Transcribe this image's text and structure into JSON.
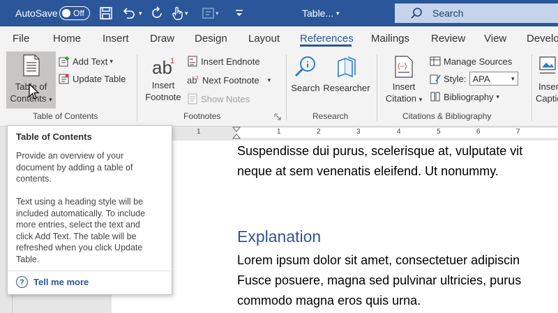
{
  "titlebar": {
    "autosave_label": "AutoSave",
    "autosave_state": "Off",
    "doc_title": "Table...",
    "search_placeholder": "Search"
  },
  "menu": {
    "tabs": [
      {
        "label": "File"
      },
      {
        "label": "Home"
      },
      {
        "label": "Insert"
      },
      {
        "label": "Draw"
      },
      {
        "label": "Design"
      },
      {
        "label": "Layout"
      },
      {
        "label": "References"
      },
      {
        "label": "Mailings"
      },
      {
        "label": "Review"
      },
      {
        "label": "View"
      },
      {
        "label": "Develo"
      }
    ],
    "active": "References"
  },
  "ribbon": {
    "toc": {
      "button_line1": "Table of",
      "button_line2": "Contents",
      "add_text": "Add Text",
      "update_table": "Update Table",
      "group_label": "Table of Contents"
    },
    "footnotes": {
      "insert_line1": "Insert",
      "insert_line2": "Footnote",
      "insert_endnote": "Insert Endnote",
      "next_footnote": "Next Footnote",
      "show_notes": "Show Notes",
      "group_label": "Footnotes"
    },
    "research": {
      "search": "Search",
      "researcher": "Researcher",
      "group_label": "Research"
    },
    "citations": {
      "insert_line1": "Insert",
      "insert_line2": "Citation",
      "manage_sources": "Manage Sources",
      "style_label": "Style:",
      "style_value": "APA",
      "bibliography": "Bibliography",
      "group_label": "Citations & Bibliography"
    },
    "captions": {
      "insert_line1": "Inser",
      "insert_line2": "Captio"
    }
  },
  "ruler": {
    "ticks": [
      "1",
      "1",
      "2",
      "3",
      "4",
      "5",
      "6",
      "7"
    ]
  },
  "document": {
    "para1_line1": "Suspendisse dui purus, scelerisque at, vulputate vit",
    "para1_line2": "neque at sem venenatis eleifend. Ut nonummy.",
    "heading": "Explanation",
    "para2_line1": "Lorem ipsum dolor sit amet, consectetuer adipiscin",
    "para2_line2": "Fusce posuere, magna sed pulvinar ultricies, purus",
    "para2_line3": "commodo magna eros quis urna."
  },
  "tooltip": {
    "title": "Table of Contents",
    "desc1_l1": "Provide an overview of your",
    "desc1_l2": "document by adding a table of",
    "desc1_l3": "contents.",
    "desc2_l1": "Text using a heading style will be",
    "desc2_l2": "included automatically. To include",
    "desc2_l3": "more entries, select the text and",
    "desc2_l4": "click Add Text. The table will be",
    "desc2_l5": "refreshed when you click Update",
    "desc2_l6": "Table.",
    "link": "Tell me more"
  },
  "colors": {
    "titlebar": "#2b579a",
    "accent": "#2b579a",
    "heading": "#2f5496"
  }
}
